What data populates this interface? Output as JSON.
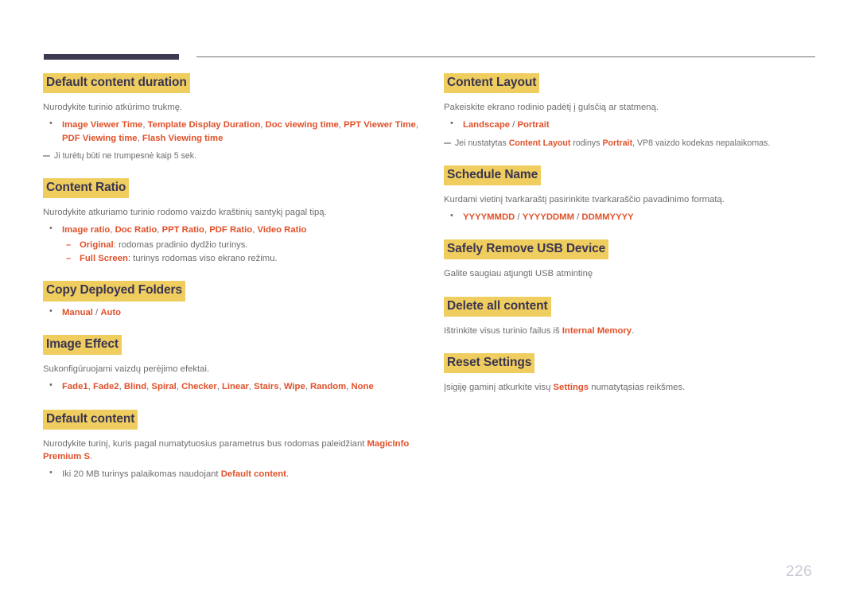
{
  "page": {
    "number": "226",
    "colors": {
      "heading_highlight": "#efcd5e",
      "heading_text": "#3a3552",
      "keyword": "#e0512a",
      "body_text": "#6d6d70",
      "note_text": "#a8a8ac",
      "rule_thick": "#3f3a52",
      "rule_thin": "#6f6f72",
      "page_number": "#c9c9d6"
    }
  },
  "left_column": {
    "sections": [
      {
        "title": "Default content duration",
        "paragraph": "Nurodykite turinio atkūrimo trukmę.",
        "bullets": [
          {
            "parts": [
              {
                "t": "Image Viewer Time",
                "k": true
              },
              {
                "t": ", ",
                "k": false
              },
              {
                "t": "Template Display Duration",
                "k": true
              },
              {
                "t": ", ",
                "k": false
              },
              {
                "t": "Doc viewing time",
                "k": true
              },
              {
                "t": ", ",
                "k": false
              },
              {
                "t": "PPT Viewer Time",
                "k": true
              },
              {
                "t": ", ",
                "k": false
              },
              {
                "t": "PDF Viewing time",
                "k": true
              },
              {
                "t": ", ",
                "k": false
              },
              {
                "t": "Flash Viewing time",
                "k": true
              }
            ]
          }
        ],
        "note": [
          {
            "t": "Ji turėtų būti ne trumpesnė kaip 5 sek.",
            "k": false
          }
        ]
      },
      {
        "title": "Content Ratio",
        "paragraph": "Nurodykite atkuriamo turinio rodomo vaizdo kraštinių santykį pagal tipą.",
        "bullets": [
          {
            "parts": [
              {
                "t": "Image ratio",
                "k": true
              },
              {
                "t": ", ",
                "k": false
              },
              {
                "t": "Doc Ratio",
                "k": true
              },
              {
                "t": ", ",
                "k": false
              },
              {
                "t": "PPT Ratio",
                "k": true
              },
              {
                "t": ", ",
                "k": false
              },
              {
                "t": "PDF Ratio",
                "k": true
              },
              {
                "t": ", ",
                "k": false
              },
              {
                "t": "Video Ratio",
                "k": true
              }
            ],
            "sub": [
              {
                "parts": [
                  {
                    "t": "Original",
                    "k": true
                  },
                  {
                    "t": ": rodomas pradinio dydžio turinys.",
                    "k": false
                  }
                ]
              },
              {
                "parts": [
                  {
                    "t": "Full Screen",
                    "k": true
                  },
                  {
                    "t": ": turinys rodomas viso ekrano režimu.",
                    "k": false
                  }
                ]
              }
            ]
          }
        ]
      },
      {
        "title": "Copy Deployed Folders",
        "bullets": [
          {
            "parts": [
              {
                "t": "Manual",
                "k": true
              },
              {
                "t": " / ",
                "k": false
              },
              {
                "t": "Auto",
                "k": true
              }
            ]
          }
        ]
      },
      {
        "title": "Image Effect",
        "paragraph": "Sukonfigūruojami vaizdų perėjimo efektai.",
        "bullets": [
          {
            "parts": [
              {
                "t": "Fade1",
                "k": true
              },
              {
                "t": ", ",
                "k": false
              },
              {
                "t": "Fade2",
                "k": true
              },
              {
                "t": ", ",
                "k": false
              },
              {
                "t": "Blind",
                "k": true
              },
              {
                "t": ", ",
                "k": false
              },
              {
                "t": "Spiral",
                "k": true
              },
              {
                "t": ", ",
                "k": false
              },
              {
                "t": "Checker",
                "k": true
              },
              {
                "t": ", ",
                "k": false
              },
              {
                "t": "Linear",
                "k": true
              },
              {
                "t": ", ",
                "k": false
              },
              {
                "t": "Stairs",
                "k": true
              },
              {
                "t": ", ",
                "k": false
              },
              {
                "t": "Wipe",
                "k": true
              },
              {
                "t": ", ",
                "k": false
              },
              {
                "t": "Random",
                "k": true
              },
              {
                "t": ", ",
                "k": false
              },
              {
                "t": "None",
                "k": true
              }
            ]
          }
        ]
      },
      {
        "title": "Default content",
        "paragraph_parts": [
          {
            "t": "Nurodykite turinį, kuris pagal numatytuosius parametrus bus rodomas paleidžiant ",
            "k": false
          },
          {
            "t": "MagicInfo Premium S",
            "k": true
          },
          {
            "t": ".",
            "k": false
          }
        ],
        "bullets": [
          {
            "parts": [
              {
                "t": "Iki 20 MB turinys palaikomas naudojant ",
                "k": false
              },
              {
                "t": "Default content",
                "k": true
              },
              {
                "t": ".",
                "k": false
              }
            ]
          }
        ]
      }
    ]
  },
  "right_column": {
    "sections": [
      {
        "title": "Content Layout",
        "paragraph": "Pakeiskite ekrano rodinio padėtį į gulsčią ar statmeną.",
        "bullets": [
          {
            "parts": [
              {
                "t": "Landscape",
                "k": true
              },
              {
                "t": " / ",
                "k": false
              },
              {
                "t": "Portrait",
                "k": true
              }
            ]
          }
        ],
        "note": [
          {
            "t": "Jei nustatytas ",
            "k": false
          },
          {
            "t": "Content Layout",
            "k": true
          },
          {
            "t": " rodinys ",
            "k": false
          },
          {
            "t": "Portrait",
            "k": true
          },
          {
            "t": ", VP8 vaizdo kodekas nepalaikomas.",
            "k": false
          }
        ]
      },
      {
        "title": "Schedule Name",
        "paragraph": "Kurdami vietinį tvarkaraštį pasirinkite tvarkaraščio pavadinimo formatą.",
        "bullets": [
          {
            "parts": [
              {
                "t": "YYYYMMDD",
                "k": true
              },
              {
                "t": " / ",
                "k": false
              },
              {
                "t": "YYYYDDMM",
                "k": true
              },
              {
                "t": " / ",
                "k": false
              },
              {
                "t": "DDMMYYYY",
                "k": true
              }
            ]
          }
        ]
      },
      {
        "title": "Safely Remove USB Device",
        "paragraph": "Galite saugiau atjungti USB atmintinę"
      },
      {
        "title": "Delete all content",
        "paragraph_parts": [
          {
            "t": "Ištrinkite visus turinio failus iš ",
            "k": false
          },
          {
            "t": "Internal Memory",
            "k": true
          },
          {
            "t": ".",
            "k": false
          }
        ]
      },
      {
        "title": "Reset Settings",
        "paragraph_parts": [
          {
            "t": "Įsigiję gaminį atkurkite visų ",
            "k": false
          },
          {
            "t": "Settings",
            "k": true
          },
          {
            "t": " numatytąsias reikšmes.",
            "k": false
          }
        ]
      }
    ]
  }
}
